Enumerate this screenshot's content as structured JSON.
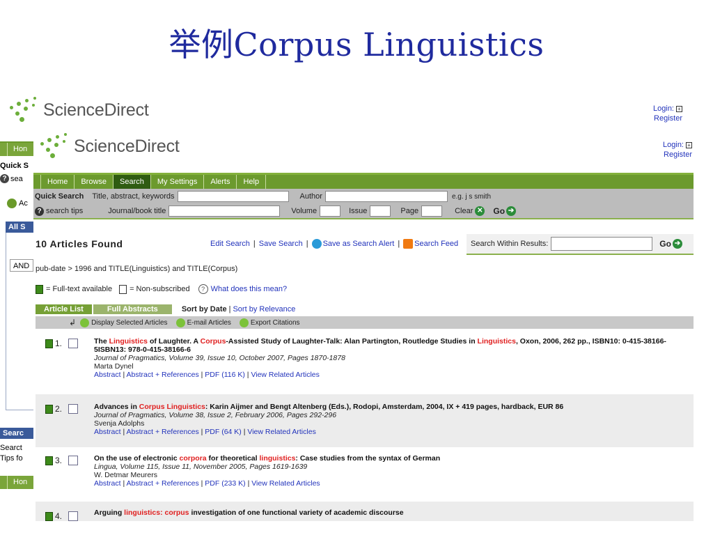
{
  "slide_title": "举例Corpus Linguistics",
  "back_page": {
    "logo_text": "ScienceDirect",
    "login_label": "Login:",
    "register_label": "Register",
    "nav_home": "Hon",
    "quick_search": "Quick S",
    "search_tips": "sea",
    "advanced": "Ac",
    "all_sources": "All S",
    "boolean": "AND",
    "search_heading": "Searc",
    "search_line1": "Searct",
    "search_line2": "Tips fo",
    "nav_home2": "Hon"
  },
  "front_page": {
    "logo_text": "ScienceDirect",
    "login_label": "Login:",
    "register_label": "Register",
    "nav": [
      "Home",
      "Browse",
      "Search",
      "My Settings",
      "Alerts",
      "Help"
    ],
    "quick_search": {
      "heading": "Quick Search",
      "field1_label": "Title, abstract, keywords",
      "author_label": "Author",
      "author_example": "e.g. j s smith",
      "search_tips": "search tips",
      "journal_label": "Journal/book title",
      "volume_label": "Volume",
      "issue_label": "Issue",
      "page_label": "Page",
      "clear_label": "Clear",
      "go_label": "Go"
    },
    "results_count": "10 Articles Found",
    "links": {
      "edit_search": "Edit Search",
      "save_search": "Save Search",
      "save_alert": "Save as Search Alert",
      "search_feed": "Search Feed"
    },
    "within": {
      "label": "Search Within Results:",
      "go_label": "Go"
    },
    "query": "pub-date > 1996 and TITLE(Linguistics) and TITLE(Corpus)",
    "legend": {
      "full_text": "= Full-text available",
      "non_subscribed": "= Non-subscribed",
      "what_mean": "What does this mean?"
    },
    "tabs": {
      "article_list": "Article List",
      "full_abstracts": "Full Abstracts",
      "sort_by_date": "Sort by Date",
      "sort_by_relevance": "Sort by Relevance"
    },
    "actions": {
      "display": "Display Selected Articles",
      "email": "E-mail Articles",
      "export": "Export Citations"
    },
    "results": [
      {
        "number": "1.",
        "title_parts": [
          "The ",
          "Linguistics",
          " of Laughter. A ",
          "Corpus",
          "-Assisted Study of Laughter-Talk: Alan Partington, Routledge Studies in ",
          "Linguistics",
          ", Oxon, 2006, 262 pp., ISBN10: 0-415-38166-5ISBN13: 978-0-415-38166-6"
        ],
        "journal": "Journal of Pragmatics, Volume 39, Issue 10, October 2007, Pages 1870-1878",
        "author": "Marta Dynel",
        "abstract": "Abstract",
        "abstract_refs": "Abstract + References",
        "pdf": "PDF (116 K)",
        "related": "View Related Articles"
      },
      {
        "number": "2.",
        "title_parts": [
          "Advances in ",
          "Corpus Linguistics",
          ": Karin Aijmer and Bengt Altenberg (Eds.), Rodopi, Amsterdam, 2004, IX + 419 pages, hardback, EUR 86"
        ],
        "journal": "Journal of Pragmatics, Volume 38, Issue 2, February 2006, Pages 292-296",
        "author": "Svenja Adolphs",
        "abstract": "Abstract",
        "abstract_refs": "Abstract + References",
        "pdf": "PDF (64 K)",
        "related": "View Related Articles"
      },
      {
        "number": "3.",
        "title_parts": [
          "On the use of electronic ",
          "corpora",
          " for theoretical ",
          "linguistics",
          ": Case studies from the syntax of German"
        ],
        "journal": "Lingua, Volume 115, Issue 11, November 2005, Pages 1619-1639",
        "author": "W. Detmar Meurers",
        "abstract": "Abstract",
        "abstract_refs": "Abstract + References",
        "pdf": "PDF (233 K)",
        "related": "View Related Articles"
      },
      {
        "number": "4.",
        "title_parts": [
          "Arguing ",
          "linguistics: corpus",
          " investigation of one functional variety of academic discourse"
        ]
      }
    ]
  }
}
